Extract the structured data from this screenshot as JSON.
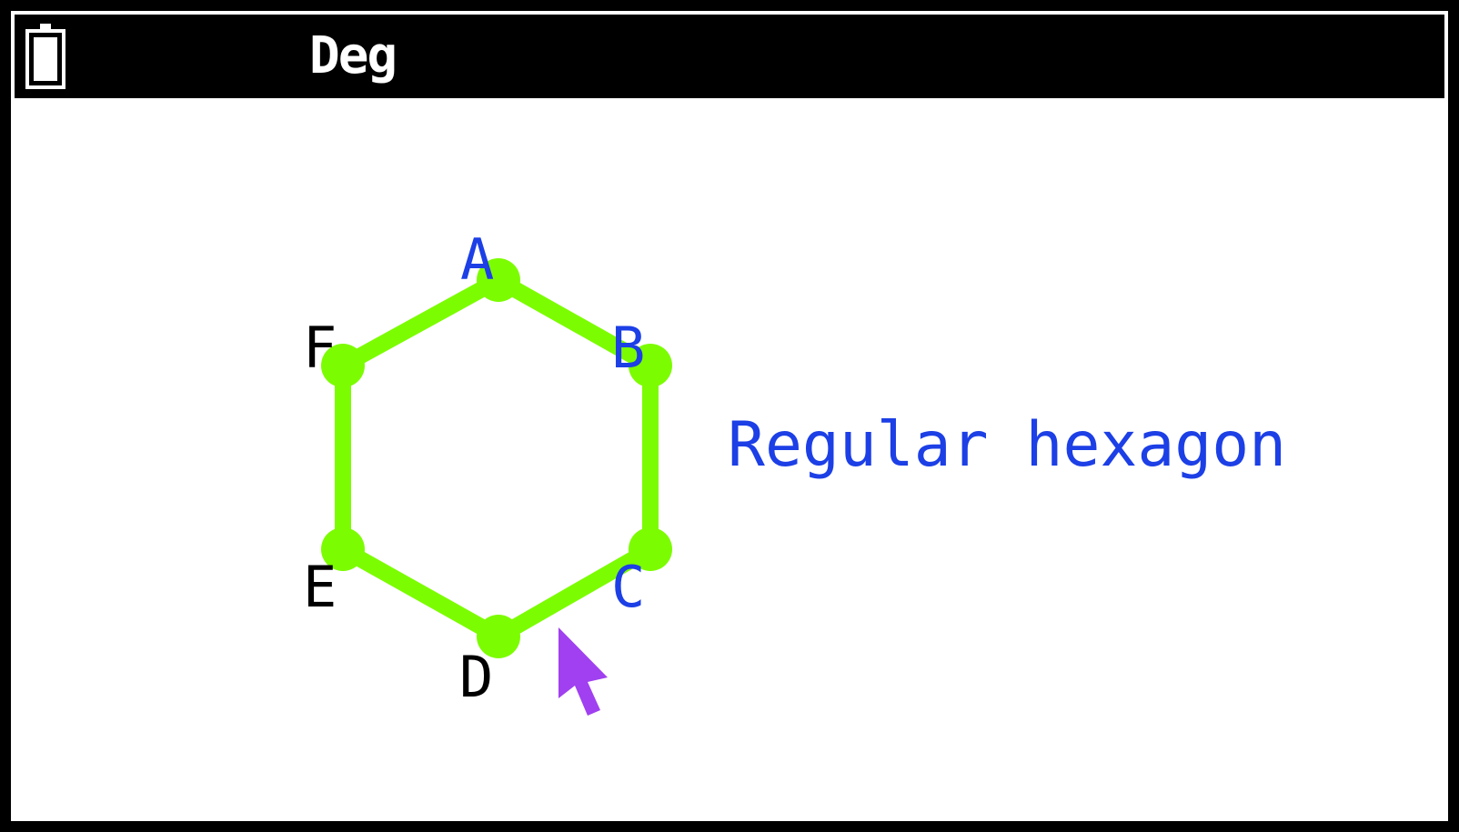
{
  "status_bar": {
    "angle_mode": "Deg",
    "battery_icon": "battery-icon"
  },
  "figure": {
    "shape_color": "#7CFC00",
    "cursor_color": "#A040F0",
    "vertices": [
      {
        "label": "A",
        "color": "#1C3FE6"
      },
      {
        "label": "B",
        "color": "#1C3FE6"
      },
      {
        "label": "C",
        "color": "#1C3FE6"
      },
      {
        "label": "D",
        "color": "#000000"
      },
      {
        "label": "E",
        "color": "#000000"
      },
      {
        "label": "F",
        "color": "#000000"
      }
    ],
    "caption": "Regular hexagon",
    "caption_color": "#1C3FE6"
  }
}
